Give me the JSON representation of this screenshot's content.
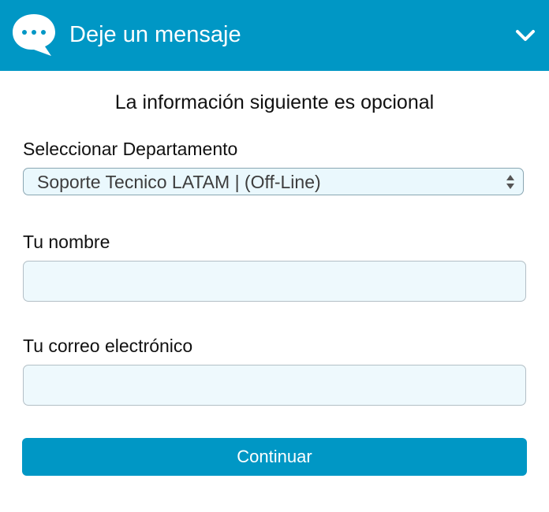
{
  "header": {
    "title": "Deje un mensaje",
    "color": "#0097c5",
    "icons": {
      "chat": "chat-bubble-icon",
      "toggle": "chevron-down-icon"
    }
  },
  "form": {
    "subtitle": "La información siguiente es opcional",
    "department": {
      "label": "Seleccionar Departamento",
      "selected": "Soporte Tecnico LATAM | (Off-Line)"
    },
    "name": {
      "label": "Tu nombre",
      "value": "",
      "placeholder": ""
    },
    "email": {
      "label": "Tu correo electrónico",
      "value": "",
      "placeholder": ""
    },
    "submit_label": "Continuar"
  }
}
